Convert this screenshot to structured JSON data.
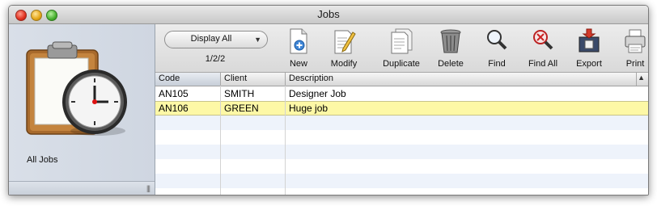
{
  "window": {
    "title": "Jobs"
  },
  "sidebar": {
    "label": "All Jobs"
  },
  "toolbar": {
    "popup_label": "Display All",
    "page_info": "1/2/2",
    "buttons": {
      "new": "New",
      "modify": "Modify",
      "duplicate": "Duplicate",
      "delete": "Delete",
      "find": "Find",
      "find_all": "Find All",
      "export": "Export",
      "print": "Print"
    }
  },
  "table": {
    "columns": [
      "Code",
      "Client",
      "Description"
    ],
    "rows": [
      {
        "code": "AN105",
        "client": "SMITH",
        "description": "Designer Job"
      },
      {
        "code": "AN106",
        "client": "GREEN",
        "description": "Huge job"
      }
    ]
  },
  "colors": {
    "selected_row": "#fdf8a6",
    "stripe": "#eef3fb",
    "sidebar": "#d4dbe5"
  }
}
